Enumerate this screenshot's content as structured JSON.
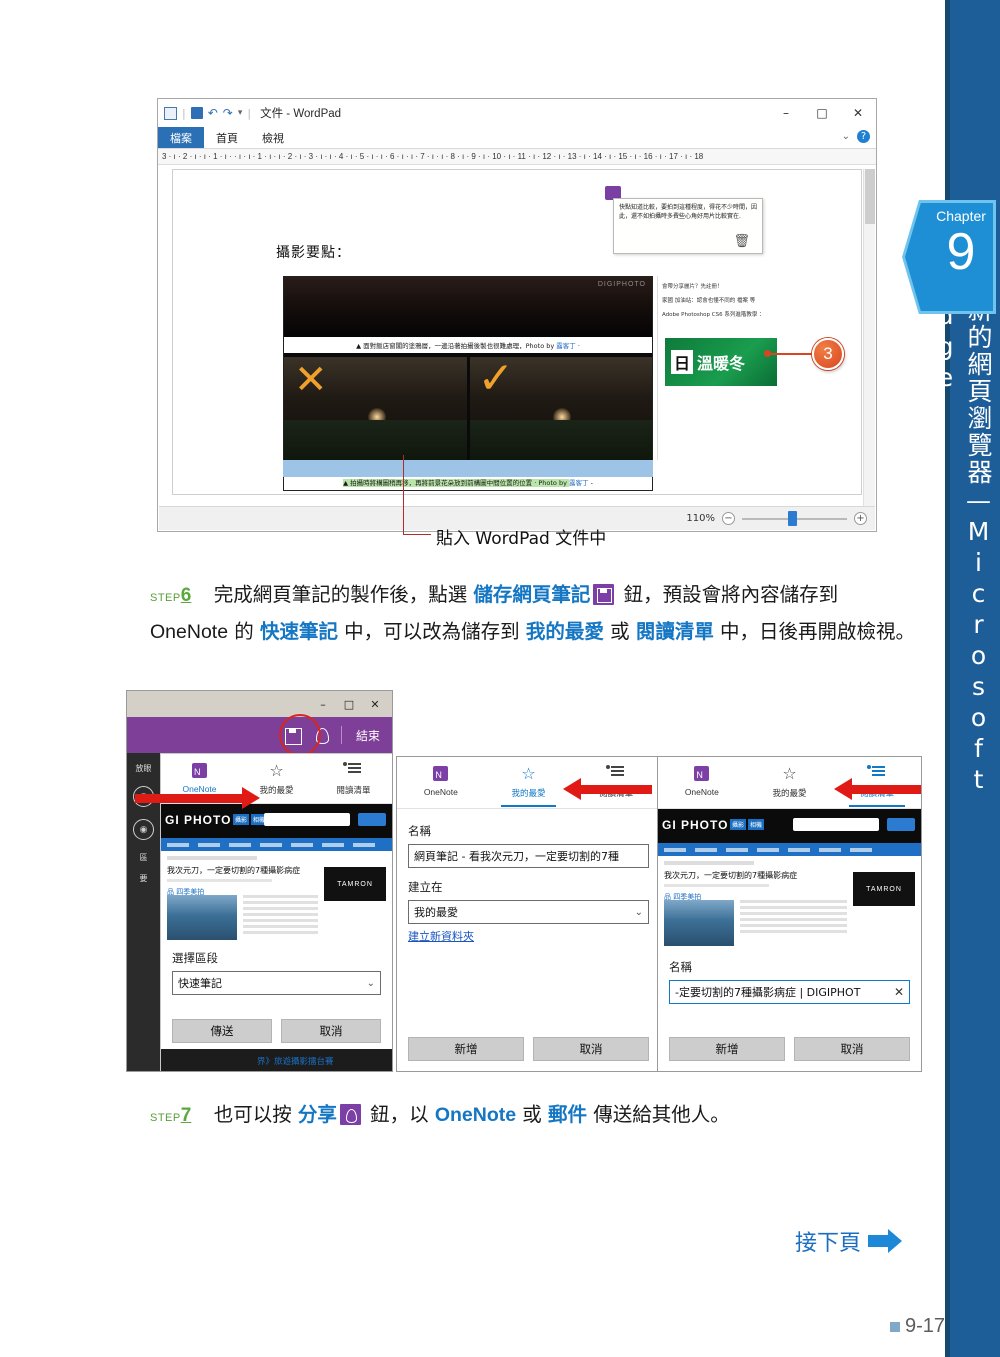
{
  "chapter": {
    "label": "Chapter",
    "number": "9",
    "vertical_title": "全新的網頁瀏覽器—Microsoft Edge"
  },
  "wordpad": {
    "title": "文件 - WordPad",
    "tabs": [
      "檔案",
      "首頁",
      "檢視"
    ],
    "win_buttons": {
      "minimize": "–",
      "maximize": "□",
      "close": "✕"
    },
    "ruler": "3 · ı · 2 · ı · ı · 1 · ı ·  · ı · ı · 1 · ı · ı · 2 · ı · 3 · ı · ı · 4 · ı · 5 · ı · ı · 6 · ı · ı · 7 · ı · ı · 8 · ı · 9 · ı · 10 · ı · 11 · ı · 12 · ı · 13 · ı · 14 · ı · 15 · ı · 16 · ı · 17 · ı · 18",
    "doc_heading": "攝影要點：",
    "caption_top_prefix": "▲ 面對飯店窗閣的塗鴉層，一邊沿著拍攝後製也很難處理，Photo by ",
    "caption_top_link": "露客丁",
    "caption_top_suffix": " ·",
    "caption_bottom_prefix": "▲ 拍攝時將構圖稍再移，再將前景花朵放到前構圖中間位置的位置 · Photo by ",
    "caption_bottom_link": "露客丁",
    "caption_bottom_suffix": " -",
    "watermark": "DIGIPHOTO",
    "note_text": "快點知道比較，要拍到這種程度，得花不少時間，因此，還不如拍攝時多費些心角好用片比較實在.",
    "side_links": [
      "會帶分享麗片？先註冊！",
      "家國 加油站：認會也懂不同的 檔案 等",
      "Adobe Photoshop CS6 系列進階教學 ："
    ],
    "green_box_kanji": "日",
    "green_box_text": "溫暖冬",
    "trash_icon": "🗑",
    "zoom_level": "110%",
    "zoom_out": "−",
    "zoom_in": "+",
    "marker_number": "3",
    "figure_caption": "貼入 WordPad 文件中"
  },
  "step6": {
    "label": "STEP",
    "number": "6",
    "parts": [
      {
        "t": "完成網頁筆記的製作後，點選 "
      },
      {
        "t": "儲存網頁筆記",
        "hi": true
      },
      {
        "icon": "save-icon"
      },
      {
        "t": " 鈕，預設會將內容儲存到 "
      },
      {
        "t": "OneNote",
        "latin": true
      },
      {
        "t": " 的 "
      },
      {
        "t": "快速筆記",
        "hi": true
      },
      {
        "t": " 中，可以改為儲存到 "
      },
      {
        "t": "我的最愛",
        "hi": true
      },
      {
        "t": " 或 "
      },
      {
        "t": "閱讀清單",
        "hi": true
      },
      {
        "t": " 中，日後再開啟檢視。"
      }
    ]
  },
  "step7": {
    "label": "STEP",
    "number": "7",
    "parts": [
      {
        "t": "也可以按 "
      },
      {
        "t": "分享",
        "hi": true
      },
      {
        "icon": "share-icon"
      },
      {
        "t": " 鈕，以 "
      },
      {
        "t": "OneNote",
        "hi": true,
        "latin": true
      },
      {
        "t": " 或 "
      },
      {
        "t": "郵件",
        "hi": true
      },
      {
        "t": " 傳送給其他人。"
      }
    ]
  },
  "panel1": {
    "win_buttons": {
      "minimize": "–",
      "maximize": "□",
      "close": "✕"
    },
    "end_button": "結束",
    "save_icon": "save-icon",
    "share_icon": "share-icon",
    "tabs": [
      {
        "label": "OneNote",
        "icon": "onenote-icon",
        "active": true
      },
      {
        "label": "我的最愛",
        "icon": "star-icon",
        "active": false
      },
      {
        "label": "閱讀清單",
        "icon": "reading-list-icon",
        "active": false
      }
    ],
    "section_label": "選擇區段",
    "section_value": "快速筆記",
    "buttons": {
      "primary": "傳送",
      "secondary": "取消"
    }
  },
  "panel2": {
    "tabs": [
      {
        "label": "OneNote",
        "icon": "onenote-icon",
        "active": false
      },
      {
        "label": "我的最愛",
        "icon": "star-icon",
        "active": true
      },
      {
        "label": "閱讀清單",
        "icon": "reading-list-icon",
        "active": false
      }
    ],
    "name_label": "名稱",
    "name_value": "網頁筆記 - 看我次元刀，一定要切割的7種",
    "createin_label": "建立在",
    "createin_value": "我的最愛",
    "new_folder_link": "建立新資料夾",
    "buttons": {
      "primary": "新增",
      "secondary": "取消"
    }
  },
  "panel3": {
    "tabs": [
      {
        "label": "OneNote",
        "icon": "onenote-icon",
        "active": false
      },
      {
        "label": "我的最愛",
        "icon": "star-icon",
        "active": false
      },
      {
        "label": "閱讀清單",
        "icon": "reading-list-icon",
        "active": true
      }
    ],
    "name_label": "名稱",
    "name_value": "-定要切割的7種攝影病症 | DIGIPHOT",
    "clear_icon": "✕",
    "buttons": {
      "primary": "新增",
      "secondary": "取消"
    }
  },
  "web_preview": {
    "logo": "GI PHOTO",
    "tags": [
      "攝影",
      "相機"
    ],
    "title": "我次元刀，一定要切割的7種攝影病症",
    "brand": "TAMRON",
    "footer_link": "界》旅遊攝影擂台賽"
  },
  "footer": {
    "next_page": "接下頁",
    "page_number": "9-17"
  },
  "colors": {
    "accent_blue": "#1577c4",
    "sidebar_blue": "#1d5e99",
    "chapter_blue": "#1e8fd5",
    "step_green": "#5ca83f",
    "edge_purple": "#7d3f98",
    "arrow_red": "#e01b16"
  }
}
